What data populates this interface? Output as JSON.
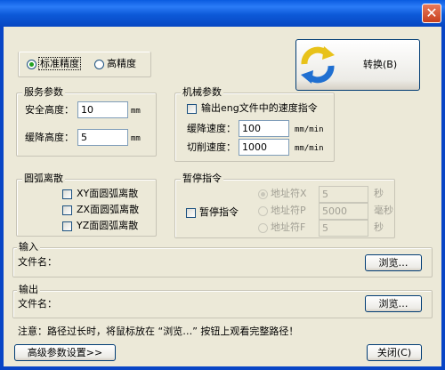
{
  "window": {
    "close_glyph": "✕"
  },
  "precision": {
    "standard_label": "标准精度",
    "high_label": "高精度"
  },
  "convert_button": {
    "label": "转换(B)"
  },
  "service_params": {
    "legend": "服务参数",
    "safe_height_label": "安全高度：",
    "safe_height_value": "10",
    "safe_height_unit": "mm",
    "descend_height_label": "缓降高度：",
    "descend_height_value": "5",
    "descend_height_unit": "mm"
  },
  "mechanical_params": {
    "legend": "机械参数",
    "output_speed_label": "输出eng文件中的速度指令",
    "descend_speed_label": "缓降速度：",
    "descend_speed_value": "100",
    "descend_speed_unit": "mm/min",
    "cut_speed_label": "切削速度：",
    "cut_speed_value": "1000",
    "cut_speed_unit": "mm/min"
  },
  "arc_discrete": {
    "legend": "圆弧离散",
    "xy_label": "XY面圆弧离散",
    "zx_label": "ZX面圆弧离散",
    "yz_label": "YZ面圆弧离散"
  },
  "pause": {
    "legend": "暂停指令",
    "pause_label": "暂停指令",
    "addr_x_label": "地址符X",
    "addr_x_value": "5",
    "addr_x_unit": "秒",
    "addr_p_label": "地址符P",
    "addr_p_value": "5000",
    "addr_p_unit": "毫秒",
    "addr_f_label": "地址符F",
    "addr_f_value": "5",
    "addr_f_unit": "秒"
  },
  "input": {
    "legend": "输入",
    "file_label": "文件名：",
    "browse_label": "浏览…"
  },
  "output": {
    "legend": "输出",
    "file_label": "文件名：",
    "browse_label": "浏览…"
  },
  "note": "注意：路径过长时，将鼠标放在 “浏览…” 按钮上观看完整路径！",
  "advanced_button": {
    "label": "高级参数设置>>"
  },
  "close_button": {
    "label": "关闭(C)"
  },
  "colors": {
    "titlebar": "#0a5be0",
    "face": "#ece9d8",
    "close": "#c7401d"
  }
}
